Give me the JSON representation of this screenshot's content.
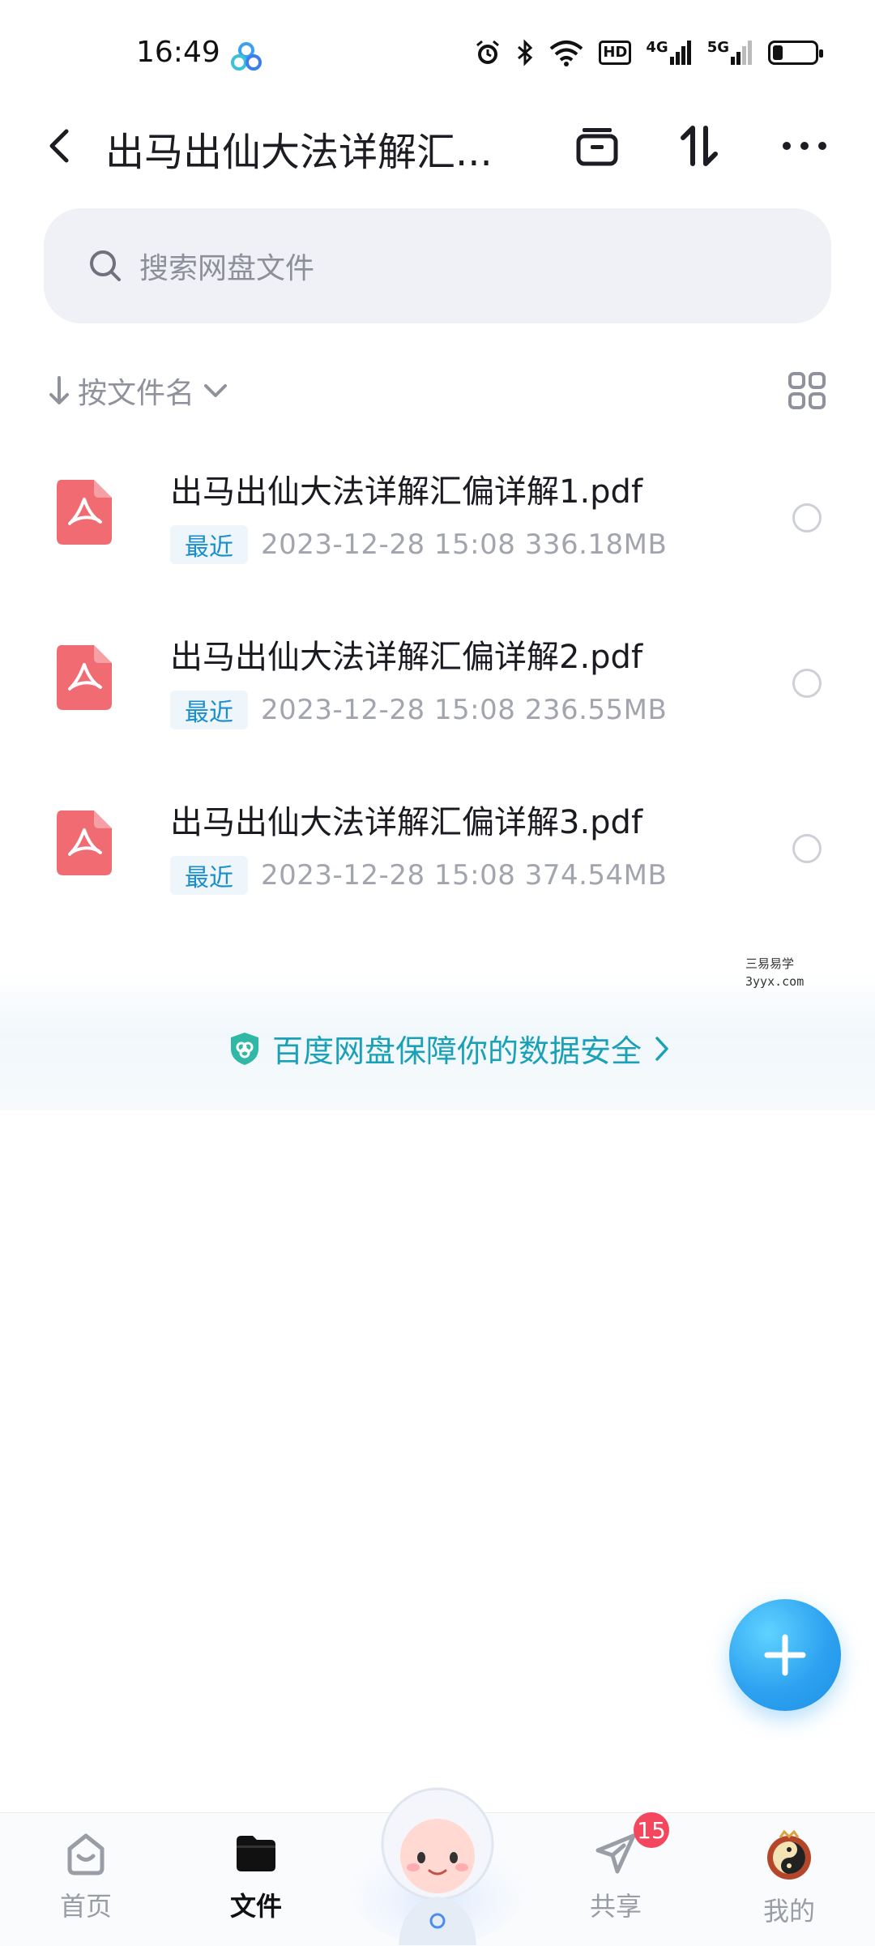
{
  "status_bar": {
    "time": "16:49",
    "network_4g": "4G",
    "network_5g": "5G",
    "hd_label": "HD"
  },
  "header": {
    "title": "出马出仙大法详解汇...",
    "icons": [
      "back-icon",
      "archive-icon",
      "transfer-icon",
      "more-icon"
    ]
  },
  "search": {
    "placeholder": "搜索网盘文件"
  },
  "sort": {
    "label": "按文件名"
  },
  "files": [
    {
      "name": "出马出仙大法详解汇偏详解1.pdf",
      "badge": "最近",
      "meta": "2023-12-28  15:08  336.18MB"
    },
    {
      "name": "出马出仙大法详解汇偏详解2.pdf",
      "badge": "最近",
      "meta": "2023-12-28  15:08  236.55MB"
    },
    {
      "name": "出马出仙大法详解汇偏详解3.pdf",
      "badge": "最近",
      "meta": "2023-12-28  15:08  374.54MB"
    }
  ],
  "watermark": {
    "line1": "三易易学",
    "line2": "3yyx.com"
  },
  "security": {
    "text": "百度网盘保障你的数据安全"
  },
  "bottom_nav": {
    "items": [
      {
        "label": "首页"
      },
      {
        "label": "文件"
      },
      {
        "label": "共享"
      },
      {
        "label": "我的"
      }
    ],
    "share_badge": "15"
  },
  "colors": {
    "accent": "#1aa1b8",
    "fab": "#2ea2f0",
    "pdf_icon": "#f16b73",
    "badge": "#f4475d"
  }
}
